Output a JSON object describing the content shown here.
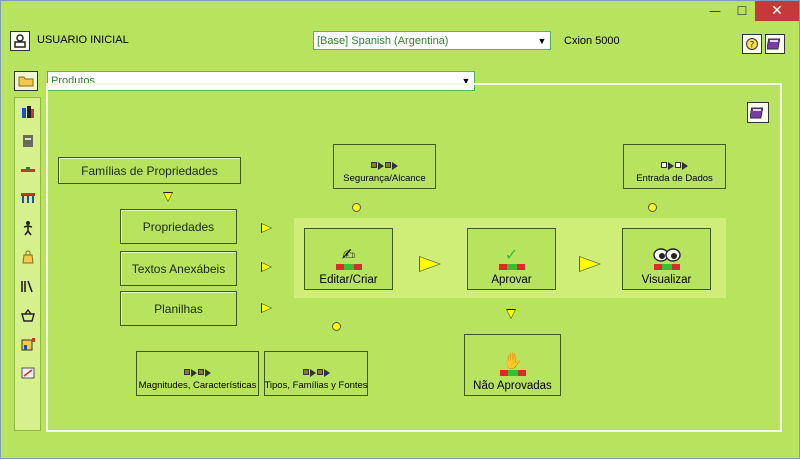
{
  "window": {
    "minimize_glyph": "—",
    "maximize_glyph": "☐",
    "close_glyph": "✕"
  },
  "header": {
    "user_label": "USUARIO INICIAL",
    "language": "[Base] Spanish (Argentina)",
    "product": "Cxion 5000"
  },
  "module": {
    "selected": "Produtos"
  },
  "workflow": {
    "families_button": "Famílias de Propriedades",
    "properties_button": "Propriedades",
    "attachments_button": "Textos Anexábeis",
    "spreadsheets_button": "Planilhas",
    "security_button": "Segurança/Alcance",
    "data_entry_button": "Entrada de Dados",
    "edit_button": "Editar/Criar",
    "approve_button": "Aprovar",
    "view_button": "Visualizar",
    "not_approved_button": "Não Aprovadas",
    "magnitudes_button": "Magnitudes, Características",
    "types_button": "Tipos, Famílias y Fontes"
  },
  "icons": {
    "user": "user-icon",
    "help": "help-icon",
    "book": "book-icon",
    "folder": "folder-icon",
    "edit": "pencil-hand-icon",
    "approve": "checkmark-icon",
    "view": "eyes-icon",
    "reject": "hand-stop-icon"
  },
  "colors": {
    "background": "#b7e35e",
    "highlight": "#cfee78",
    "arrow": "#ffff00",
    "close": "#c7383b"
  }
}
